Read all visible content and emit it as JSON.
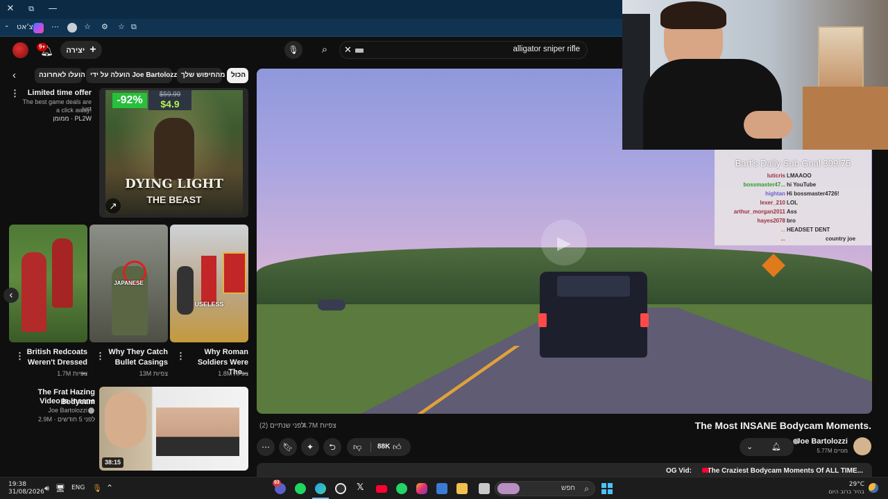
{
  "browser": {
    "window_controls": {
      "close": "✕",
      "restore": "⧉",
      "minimize": "—"
    },
    "profile_label": "צ'אט"
  },
  "youtube": {
    "create_label": "יצירה",
    "notifications_badge": "9+",
    "search": {
      "query": "alligator sniper rifle"
    },
    "chips": [
      {
        "label": "הכול",
        "active": true
      },
      {
        "label": "מהחיפוש שלך",
        "active": false
      },
      {
        "label": "הועלה על ידי Joe Bartolozzi",
        "active": false
      },
      {
        "label": "הועלו לאחרונה",
        "active": false
      }
    ],
    "ad": {
      "title": "Limited time offer",
      "description_line1": "The best game deals are just",
      "description_line2": "a click away!",
      "sponsor": "ממומן · PL2W",
      "discount": "-92%",
      "old_price": "$59.99",
      "new_price": "$4.9",
      "game_title_line1": "DYING LIGHT",
      "game_title_line2": "THE BEAST"
    },
    "shorts": [
      {
        "title_line1": "British Redcoats",
        "title_line2": "Weren't Dressed ...",
        "views": "1.7M צפיות",
        "overlay": ""
      },
      {
        "title_line1": "Why They Catch",
        "title_line2": "Bullet Casings",
        "views": "13M צפיות",
        "overlay": "JAPANESE"
      },
      {
        "title_line1": "Why Roman",
        "title_line2": "Soldiers Were The...",
        "views": "1.8M צפיות",
        "overlay": "USELESS"
      }
    ],
    "related": {
      "title_line1": "The Frat Hazing Bodycam",
      "title_line2": "Video Is Insane",
      "channel": "Joe Bartolozzi",
      "meta": "2.9M · לפני 5 חודשים",
      "duration": "38:15"
    },
    "video": {
      "title": "The Most INSANE Bodycam Moments.",
      "views": "4.7M צפיות",
      "uploaded": "לפני שנתיים (2)",
      "channel": "Joe Bartolozzi",
      "subscribers": "5.77M מנויים",
      "likes": "88K",
      "description_prefix": "OG Vid:",
      "description_link": "The Craziest Bodycam Moments Of ALL TIME..."
    }
  },
  "stream_overlay": {
    "chat_title": "Bart's Daily Sub Goal 309/75",
    "messages": [
      {
        "user": "luticris",
        "text": "LMAAOO"
      },
      {
        "user": "bossmaster47...",
        "text": "hi YouTube"
      },
      {
        "user": "hightan",
        "text": "Hi bossmaster4726!"
      },
      {
        "user": "lexer_210",
        "text": "LOL"
      },
      {
        "user": "arthur_morgan2011",
        "text": "Ass"
      },
      {
        "user": "hayes2078",
        "text": "bro"
      },
      {
        "user": "...",
        "text": "HEADSET DENT"
      },
      {
        "user": "...",
        "text": "country joe"
      }
    ]
  },
  "taskbar": {
    "time": "19:38",
    "date": "31/08/2026",
    "language": "ENG",
    "search_placeholder": "חפש",
    "weather_temp": "29°C",
    "weather_desc": "בהיר ברוב היום",
    "chat_badge": "93"
  },
  "colors": {
    "youtube_red": "#ff0033",
    "taskbar_bg": "#1c1c1c",
    "browser_titlebar": "#0c2a43"
  }
}
